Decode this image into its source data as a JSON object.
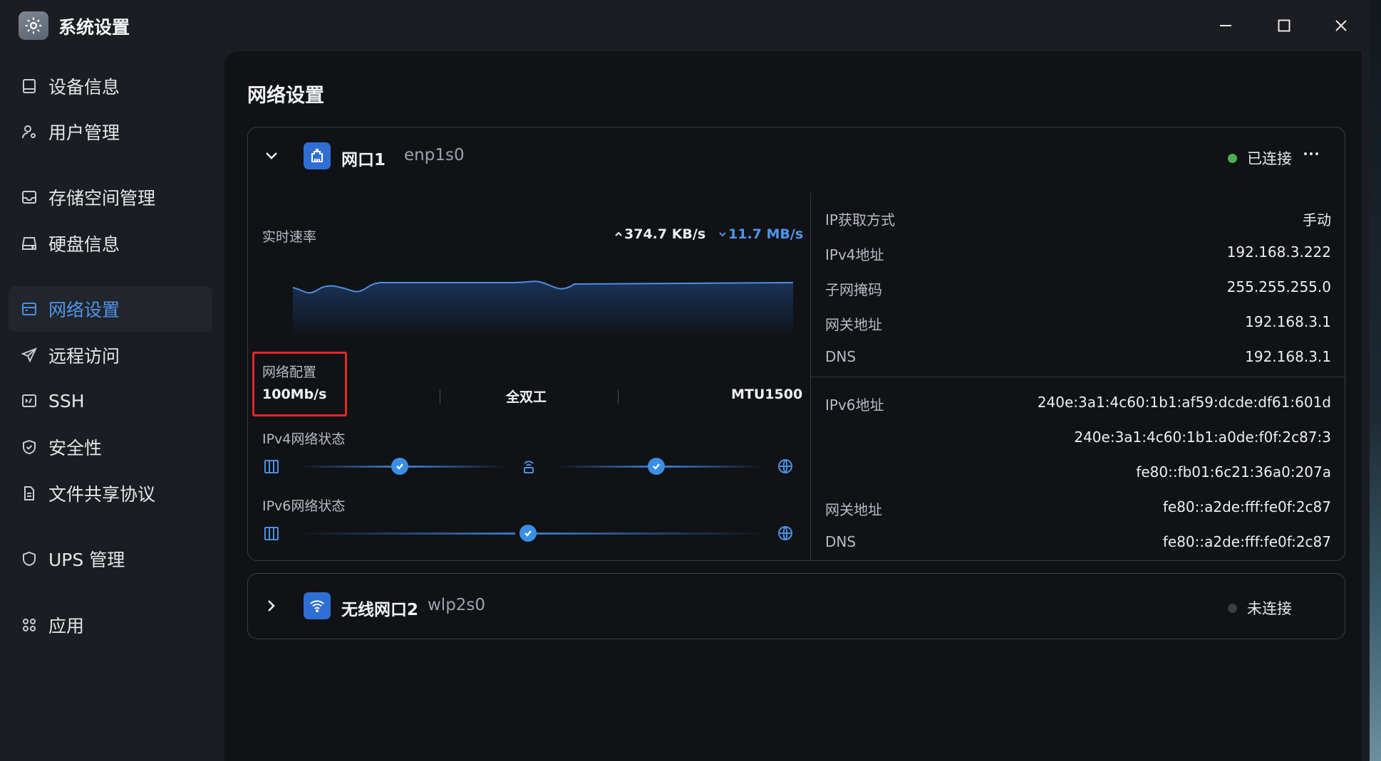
{
  "window": {
    "title": "系统设置"
  },
  "sidebar": {
    "items": [
      {
        "label": "设备信息",
        "icon": "device-icon"
      },
      {
        "label": "用户管理",
        "icon": "user-gear-icon"
      },
      {
        "label": "存储空间管理",
        "icon": "storage-icon"
      },
      {
        "label": "硬盘信息",
        "icon": "disk-icon"
      },
      {
        "label": "网络设置",
        "icon": "network-icon",
        "active": true
      },
      {
        "label": "远程访问",
        "icon": "send-icon"
      },
      {
        "label": "SSH",
        "icon": "terminal-icon"
      },
      {
        "label": "安全性",
        "icon": "shield-check-icon"
      },
      {
        "label": "文件共享协议",
        "icon": "file-icon"
      },
      {
        "label": "UPS 管理",
        "icon": "shield-icon"
      },
      {
        "label": "应用",
        "icon": "apps-icon"
      }
    ]
  },
  "main": {
    "title": "网络设置",
    "port1": {
      "name": "网口1",
      "device": "enp1s0",
      "status": "已连接",
      "status_color": "#4caf50",
      "speed": {
        "label": "实时速率",
        "upload": "374.7 KB/s",
        "download": "11.7 MB/s"
      },
      "config": {
        "label": "网络配置",
        "speed": "100Mb/s",
        "duplex": "全双工",
        "mtu": "MTU1500"
      },
      "ipv4_status_label": "IPv4网络状态",
      "ipv6_status_label": "IPv6网络状态",
      "info_v4": [
        {
          "key": "IP获取方式",
          "value": "手动"
        },
        {
          "key": "IPv4地址",
          "value": "192.168.3.222"
        },
        {
          "key": "子网掩码",
          "value": "255.255.255.0"
        },
        {
          "key": "网关地址",
          "value": "192.168.3.1"
        },
        {
          "key": "DNS",
          "value": "192.168.3.1"
        }
      ],
      "info_v6": [
        {
          "key": "IPv6地址",
          "value": "240e:3a1:4c60:1b1:af59:dcde:df61:601d"
        },
        {
          "key": "",
          "value": "240e:3a1:4c60:1b1:a0de:f0f:2c87:3"
        },
        {
          "key": "",
          "value": "fe80::fb01:6c21:36a0:207a"
        },
        {
          "key": "网关地址",
          "value": "fe80::a2de:fff:fe0f:2c87"
        },
        {
          "key": "DNS",
          "value": "fe80::a2de:fff:fe0f:2c87"
        }
      ]
    },
    "port2": {
      "name": "无线网口2",
      "device": "wlp2s0",
      "status": "未连接",
      "status_color": "#3a3d44"
    }
  },
  "colors": {
    "accent": "#4a90e2",
    "highlight": "#e8262a"
  }
}
